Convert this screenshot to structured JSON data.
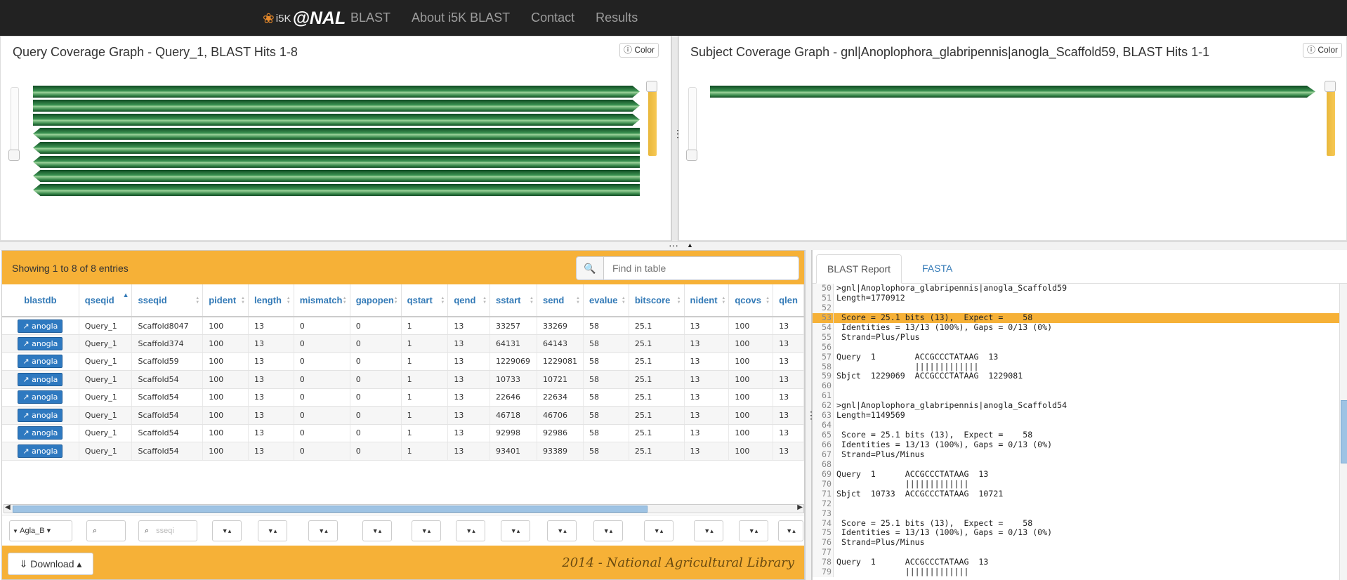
{
  "nav": {
    "brand_i5k": "i5K",
    "brand_nal": "@NAL",
    "items": [
      "BLAST",
      "About i5K BLAST",
      "Contact",
      "Results"
    ]
  },
  "query_graph": {
    "title": "Query Coverage Graph - Query_1, BLAST Hits 1-8",
    "color_label": "Color",
    "hits": 8
  },
  "subject_graph": {
    "title": "Subject Coverage Graph - gnl|Anoplophora_glabripennis|anogla_Scaffold59, BLAST Hits 1-1",
    "color_label": "Color",
    "hits": 1
  },
  "grid": {
    "entries_text": "Showing 1 to 8 of 8 entries",
    "search_placeholder": "Find in table",
    "columns": [
      "blastdb",
      "qseqid",
      "sseqid",
      "pident",
      "length",
      "mismatch",
      "gapopen",
      "qstart",
      "qend",
      "sstart",
      "send",
      "evalue",
      "bitscore",
      "nident",
      "qcovs",
      "qlen"
    ],
    "rows": [
      [
        "anogla",
        "Query_1",
        "Scaffold8047",
        "100",
        "13",
        "0",
        "0",
        "1",
        "13",
        "33257",
        "33269",
        "58",
        "25.1",
        "13",
        "100",
        "13"
      ],
      [
        "anogla",
        "Query_1",
        "Scaffold374",
        "100",
        "13",
        "0",
        "0",
        "1",
        "13",
        "64131",
        "64143",
        "58",
        "25.1",
        "13",
        "100",
        "13"
      ],
      [
        "anogla",
        "Query_1",
        "Scaffold59",
        "100",
        "13",
        "0",
        "0",
        "1",
        "13",
        "1229069",
        "1229081",
        "58",
        "25.1",
        "13",
        "100",
        "13"
      ],
      [
        "anogla",
        "Query_1",
        "Scaffold54",
        "100",
        "13",
        "0",
        "0",
        "1",
        "13",
        "10733",
        "10721",
        "58",
        "25.1",
        "13",
        "100",
        "13"
      ],
      [
        "anogla",
        "Query_1",
        "Scaffold54",
        "100",
        "13",
        "0",
        "0",
        "1",
        "13",
        "22646",
        "22634",
        "58",
        "25.1",
        "13",
        "100",
        "13"
      ],
      [
        "anogla",
        "Query_1",
        "Scaffold54",
        "100",
        "13",
        "0",
        "0",
        "1",
        "13",
        "46718",
        "46706",
        "58",
        "25.1",
        "13",
        "100",
        "13"
      ],
      [
        "anogla",
        "Query_1",
        "Scaffold54",
        "100",
        "13",
        "0",
        "0",
        "1",
        "13",
        "92998",
        "92986",
        "58",
        "25.1",
        "13",
        "100",
        "13"
      ],
      [
        "anogla",
        "Query_1",
        "Scaffold54",
        "100",
        "13",
        "0",
        "0",
        "1",
        "13",
        "93401",
        "93389",
        "58",
        "25.1",
        "13",
        "100",
        "13"
      ]
    ],
    "filter_select": "Agla_B",
    "filter_sseqid_placeholder": "sseqi",
    "download_label": "Download",
    "footer": "2014 - National Agricultural Library"
  },
  "report": {
    "tabs": [
      "BLAST Report",
      "FASTA"
    ],
    "highlight_line": 53,
    "lines": [
      {
        "n": "50",
        "t": ">gnl|Anoplophora_glabripennis|anogla_Scaffold59"
      },
      {
        "n": "51",
        "t": "Length=1770912"
      },
      {
        "n": "52",
        "t": ""
      },
      {
        "n": "53",
        "t": " Score = 25.1 bits (13),  Expect =    58"
      },
      {
        "n": "54",
        "t": " Identities = 13/13 (100%), Gaps = 0/13 (0%)"
      },
      {
        "n": "55",
        "t": " Strand=Plus/Plus"
      },
      {
        "n": "56",
        "t": ""
      },
      {
        "n": "57",
        "t": "Query  1        ACCGCCCTATAAG  13"
      },
      {
        "n": "58",
        "t": "                |||||||||||||"
      },
      {
        "n": "59",
        "t": "Sbjct  1229069  ACCGCCCTATAAG  1229081"
      },
      {
        "n": "60",
        "t": ""
      },
      {
        "n": "61",
        "t": ""
      },
      {
        "n": "62",
        "t": ">gnl|Anoplophora_glabripennis|anogla_Scaffold54"
      },
      {
        "n": "63",
        "t": "Length=1149569"
      },
      {
        "n": "64",
        "t": ""
      },
      {
        "n": "65",
        "t": " Score = 25.1 bits (13),  Expect =    58"
      },
      {
        "n": "66",
        "t": " Identities = 13/13 (100%), Gaps = 0/13 (0%)"
      },
      {
        "n": "67",
        "t": " Strand=Plus/Minus"
      },
      {
        "n": "68",
        "t": ""
      },
      {
        "n": "69",
        "t": "Query  1      ACCGCCCTATAAG  13"
      },
      {
        "n": "70",
        "t": "              |||||||||||||"
      },
      {
        "n": "71",
        "t": "Sbjct  10733  ACCGCCCTATAAG  10721"
      },
      {
        "n": "72",
        "t": ""
      },
      {
        "n": "73",
        "t": ""
      },
      {
        "n": "74",
        "t": " Score = 25.1 bits (13),  Expect =    58"
      },
      {
        "n": "75",
        "t": " Identities = 13/13 (100%), Gaps = 0/13 (0%)"
      },
      {
        "n": "76",
        "t": " Strand=Plus/Minus"
      },
      {
        "n": "77",
        "t": ""
      },
      {
        "n": "78",
        "t": "Query  1      ACCGCCCTATAAG  13"
      },
      {
        "n": "79",
        "t": "              |||||||||||||"
      }
    ]
  }
}
